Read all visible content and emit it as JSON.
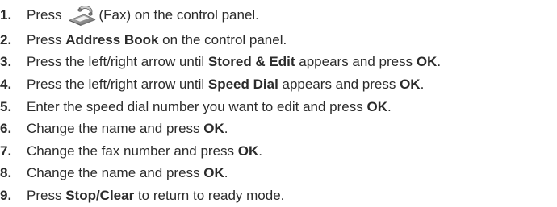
{
  "steps": [
    {
      "num": "1.",
      "parts": [
        "Press ",
        "",
        "(Fax) on the control panel."
      ],
      "icon": "fax-icon"
    },
    {
      "num": "2.",
      "parts": [
        "Press ",
        "Address Book",
        " on the control panel."
      ]
    },
    {
      "num": "3.",
      "parts": [
        "Press the left/right arrow until ",
        "Stored & Edit",
        " appears and press ",
        "OK",
        "."
      ]
    },
    {
      "num": "4.",
      "parts": [
        "Press the left/right arrow until ",
        "Speed Dial",
        " appears and press ",
        "OK",
        "."
      ]
    },
    {
      "num": "5.",
      "parts": [
        "Enter the speed dial number you want to edit and press ",
        "OK",
        "."
      ]
    },
    {
      "num": "6.",
      "parts": [
        "Change the name and press ",
        "OK",
        "."
      ]
    },
    {
      "num": "7.",
      "parts": [
        "Change the fax number and press ",
        "OK",
        "."
      ]
    },
    {
      "num": "8.",
      "parts": [
        "Change the name and press ",
        "OK",
        "."
      ]
    },
    {
      "num": "9.",
      "parts": [
        "Press ",
        "Stop/Clear",
        " to return to ready mode."
      ]
    }
  ]
}
